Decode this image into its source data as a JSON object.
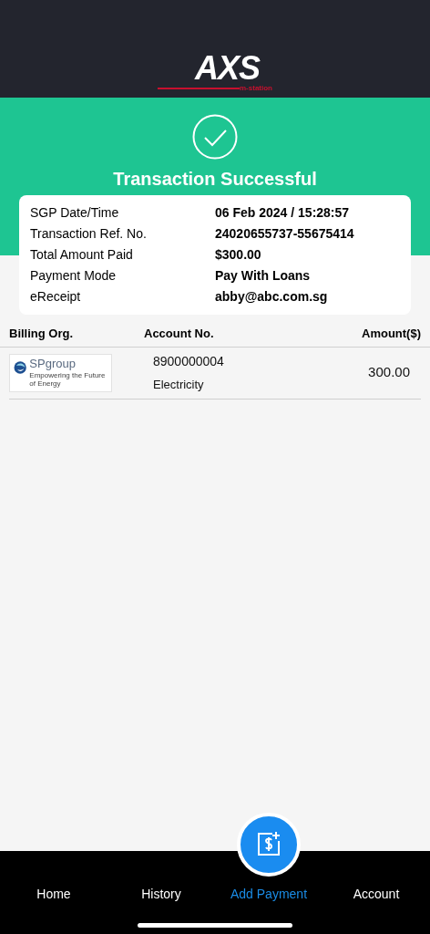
{
  "header": {
    "logo": "AXS",
    "logo_sub": "m-station"
  },
  "status": {
    "title": "Transaction Successful"
  },
  "details": [
    {
      "label": "SGP Date/Time",
      "value": "06 Feb 2024 / 15:28:57"
    },
    {
      "label": "Transaction Ref. No.",
      "value": "24020655737-55675414"
    },
    {
      "label": "Total Amount Paid",
      "value": "$300.00"
    },
    {
      "label": "Payment Mode",
      "value": "Pay With Loans"
    },
    {
      "label": "eReceipt",
      "value": "abby@abc.com.sg"
    }
  ],
  "table": {
    "columns": [
      "Billing Org.",
      "Account No.",
      "Amount($)"
    ],
    "rows": [
      {
        "org_logo": "SPgroup",
        "org_tagline": "Empowering the Future of Energy",
        "account": "8900000004",
        "type": "Electricity",
        "amount": "300.00"
      }
    ]
  },
  "nav": [
    {
      "label": "Home",
      "selected": false
    },
    {
      "label": "History",
      "selected": false
    },
    {
      "label": "Add Payment",
      "selected": true
    },
    {
      "label": "Account",
      "selected": false
    }
  ]
}
